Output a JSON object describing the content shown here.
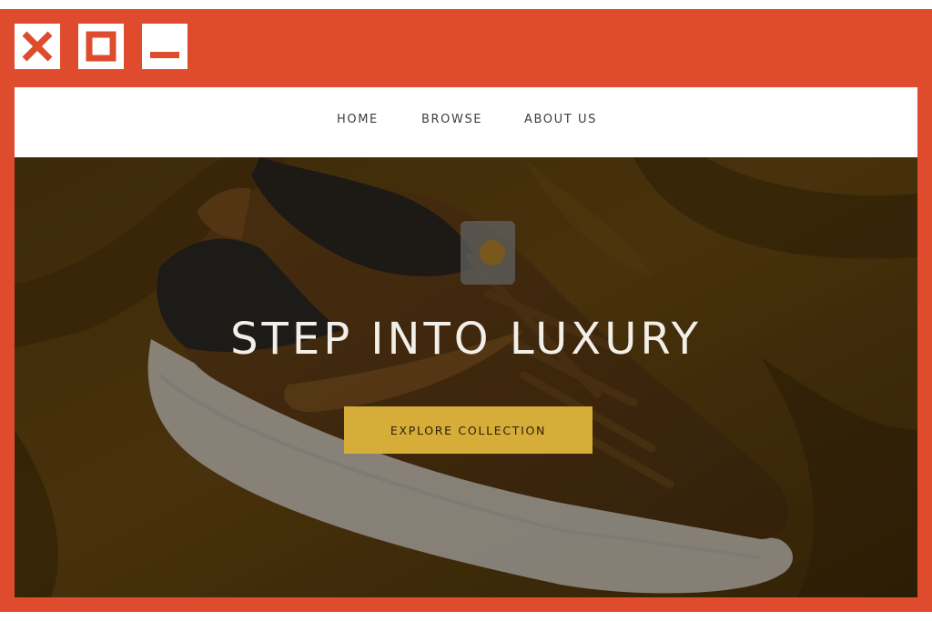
{
  "window": {
    "frame_color": "#de4c2d",
    "controls": [
      {
        "name": "close",
        "icon": "close-icon"
      },
      {
        "name": "maximize",
        "icon": "maximize-icon"
      },
      {
        "name": "minimize",
        "icon": "minimize-icon"
      }
    ]
  },
  "nav": {
    "items": [
      {
        "label": "HOME"
      },
      {
        "label": "BROWSE"
      },
      {
        "label": "ABOUT US"
      }
    ]
  },
  "hero": {
    "image": "sneaker-on-mustard-fabric",
    "title": "STEP INTO LUXURY",
    "cta_label": "EXPLORE COLLECTION",
    "cta_color": "#d7ad3a"
  }
}
